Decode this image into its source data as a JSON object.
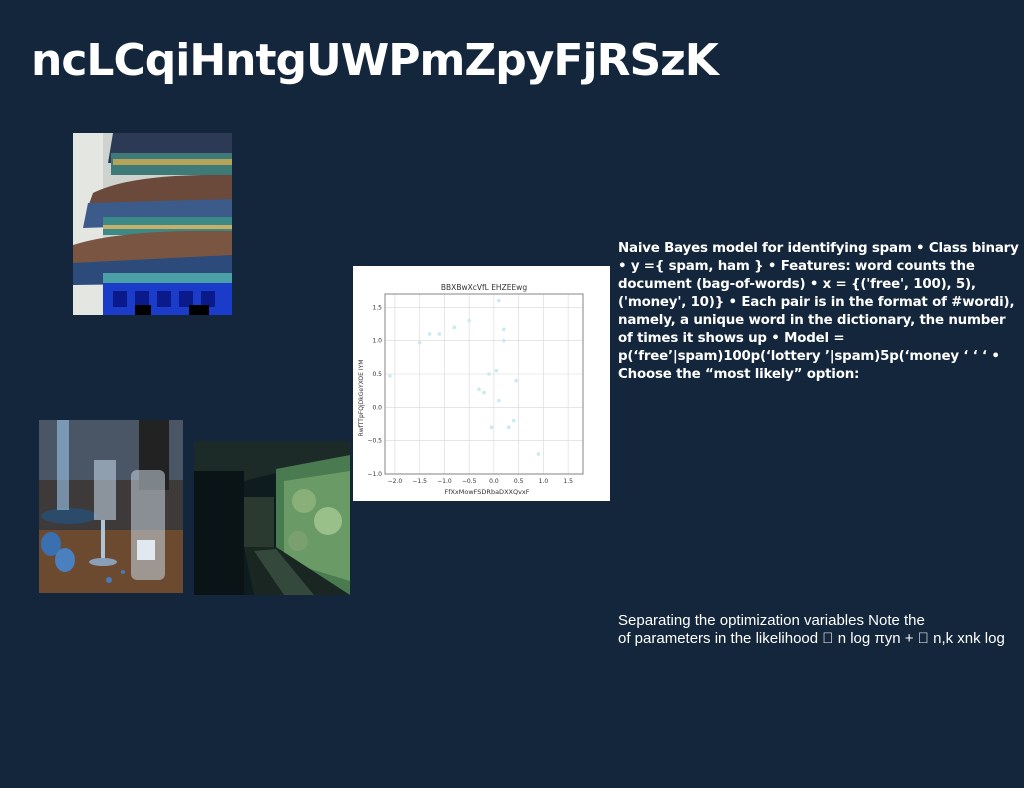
{
  "title": "ncLCqiHntgUWPmZpyFjRSzK",
  "body_text": "Naive Bayes model for identifying spam • Class binary • y ={ spam, ham } • Features: word counts the document (bag-of-words) • x = {('free', 100), 5), ('money', 10)} • Each pair is in the format of #wordi), namely, a unique word in the dictionary, the number of times it shows up • Model = p(‘free’|spam)100p(‘lottery ’|spam)5p(‘money ‘ ‘ ‘ • Choose the “most likely” option:",
  "note": {
    "line1": "Separating the optimization variables Note the",
    "line2": "of parameters in the likelihood \u0000 n log πyn + \u0000 n,k xnk log"
  },
  "images": {
    "temple": "temple-of-heaven-photo",
    "glasses": "champagne-glasses-photo",
    "corridor": "garden-corridor-photo"
  },
  "chart_data": {
    "type": "scatter",
    "title": "BBXBwXcVfL EHZEEwg",
    "xlabel": "FfXxMowFSDRbaDXXQvxF",
    "ylabel": "RwfTTpFQjDkGeYXOE IYM",
    "xlim": [
      -2.2,
      1.8
    ],
    "ylim": [
      -1.0,
      1.7
    ],
    "xticks": [
      "−2.0",
      "−1.5",
      "−1.0",
      "−0.5",
      "0.0",
      "0.5",
      "1.0",
      "1.5"
    ],
    "yticks": [
      "−1.0",
      "−0.5",
      "0.0",
      "0.5",
      "1.0",
      "1.5"
    ],
    "grid": true,
    "point_color": "#c8eaf0",
    "points": [
      [
        -2.1,
        0.47
      ],
      [
        -1.5,
        0.97
      ],
      [
        -1.3,
        1.1
      ],
      [
        -1.1,
        1.1
      ],
      [
        -0.8,
        1.2
      ],
      [
        -0.5,
        1.3
      ],
      [
        -0.3,
        0.27
      ],
      [
        -0.1,
        0.5
      ],
      [
        0.05,
        0.55
      ],
      [
        -0.2,
        0.22
      ],
      [
        0.1,
        1.6
      ],
      [
        0.2,
        1.17
      ],
      [
        0.2,
        1.0
      ],
      [
        0.1,
        0.1
      ],
      [
        -0.05,
        -0.3
      ],
      [
        0.3,
        -0.3
      ],
      [
        0.4,
        -0.2
      ],
      [
        0.45,
        0.4
      ],
      [
        0.9,
        -0.7
      ]
    ]
  }
}
